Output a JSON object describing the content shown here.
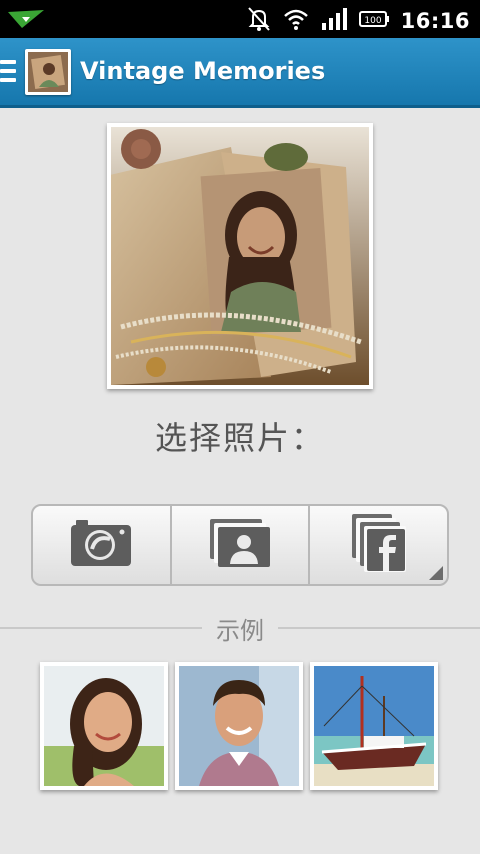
{
  "status_bar": {
    "time": "16:16",
    "icons": [
      "app-notification-icon",
      "vibrate-off-icon",
      "wifi-icon",
      "signal-icon",
      "battery-icon"
    ],
    "battery_text": "100"
  },
  "action_bar": {
    "title": "Vintage Memories",
    "color": "#2386bd"
  },
  "main": {
    "choose_label": "选择照片：",
    "sources": [
      {
        "name": "camera",
        "icon": "camera-icon"
      },
      {
        "name": "gallery",
        "icon": "gallery-icon"
      },
      {
        "name": "facebook",
        "icon": "facebook-album-icon"
      }
    ]
  },
  "examples": {
    "label": "示例",
    "items": [
      "woman-portrait",
      "man-portrait",
      "boat"
    ]
  }
}
